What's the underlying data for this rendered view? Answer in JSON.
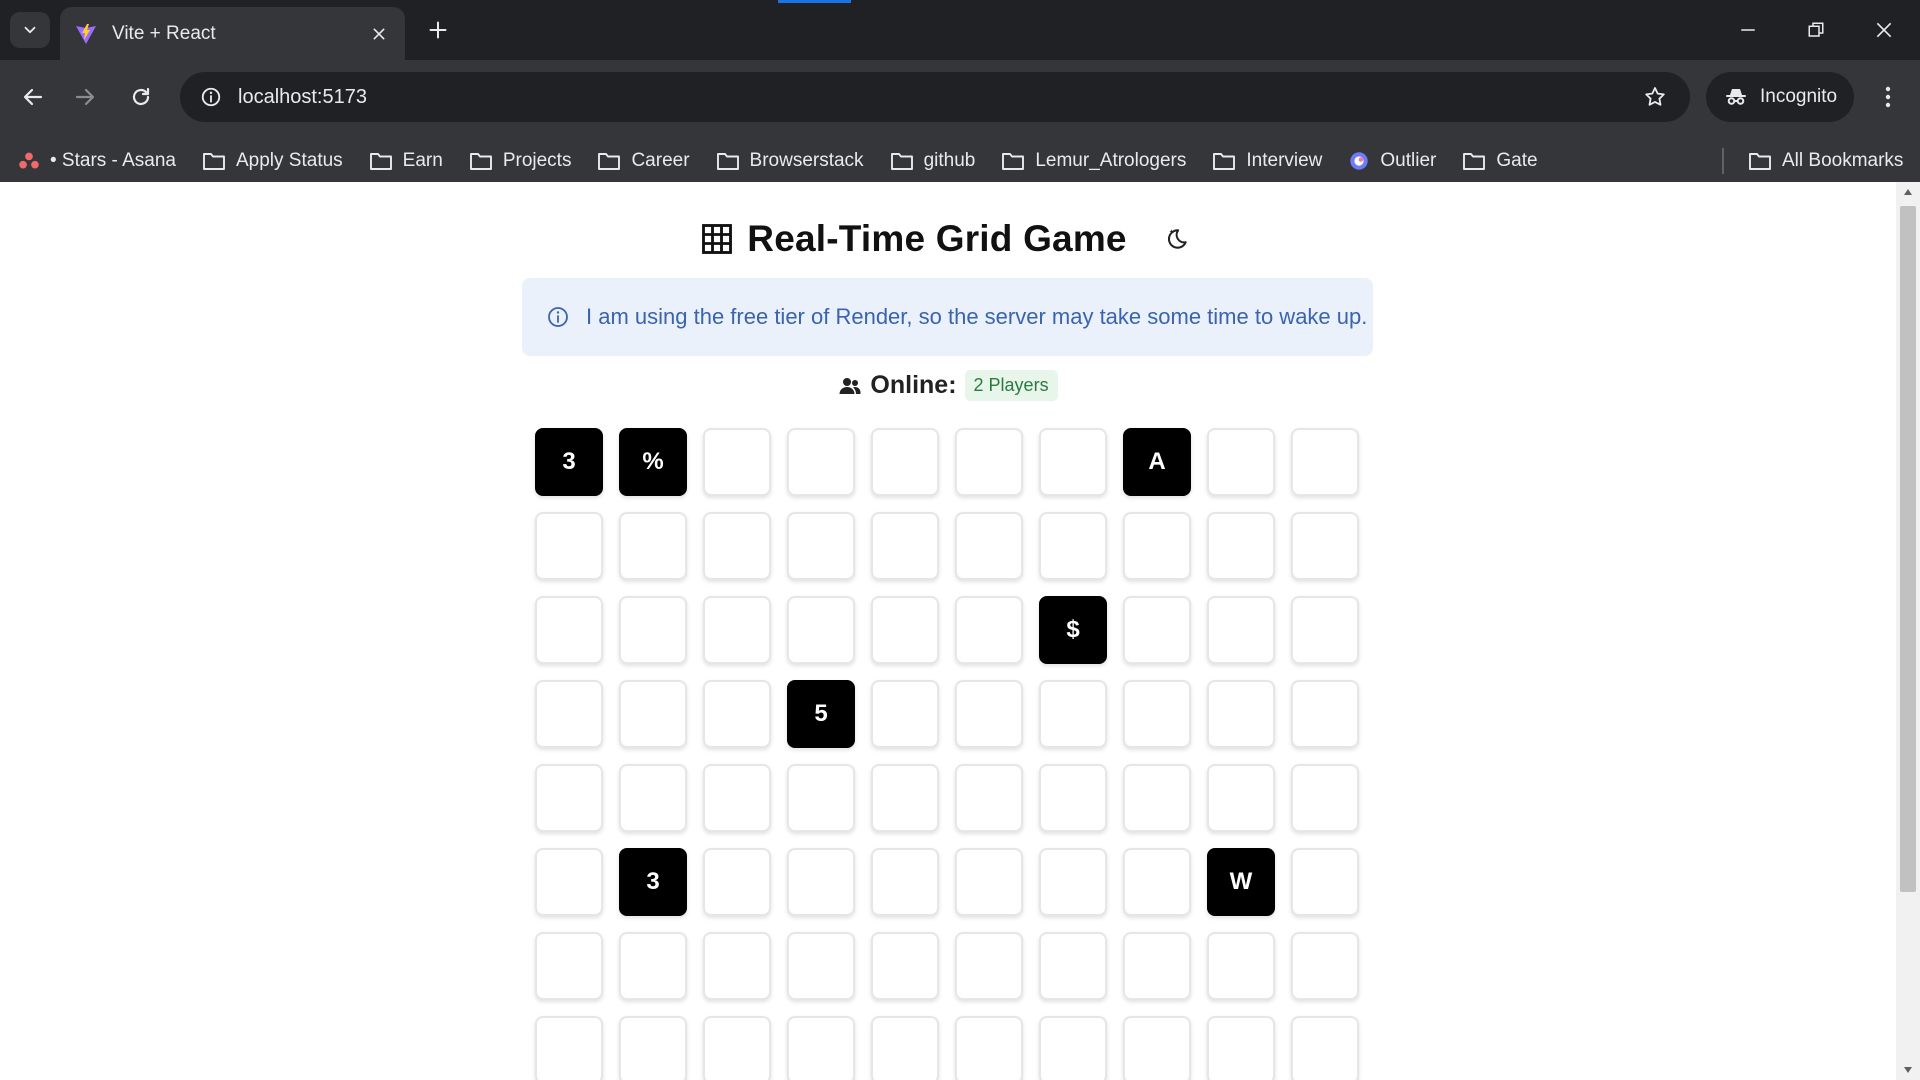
{
  "browser": {
    "tab_title": "Vite + React",
    "url": "localhost:5173",
    "profile_label": "Incognito",
    "bookmarks": [
      {
        "label": "• Stars - Asana",
        "icon": "asana-icon"
      },
      {
        "label": "Apply Status",
        "icon": "folder-icon"
      },
      {
        "label": "Earn",
        "icon": "folder-icon"
      },
      {
        "label": "Projects",
        "icon": "folder-icon"
      },
      {
        "label": "Career",
        "icon": "folder-icon"
      },
      {
        "label": "Browserstack",
        "icon": "folder-icon"
      },
      {
        "label": "github",
        "icon": "folder-icon"
      },
      {
        "label": "Lemur_Atrologers",
        "icon": "folder-icon"
      },
      {
        "label": "Interview",
        "icon": "folder-icon"
      },
      {
        "label": "Outlier",
        "icon": "outlier-icon"
      },
      {
        "label": "Gate",
        "icon": "folder-icon"
      }
    ],
    "all_bookmarks_label": "All Bookmarks"
  },
  "page": {
    "title": "Real-Time Grid Game",
    "notice": "I am using the free tier of Render, so the server may take some time to wake up.",
    "online_label": "Online:",
    "players_badge": "2 Players"
  },
  "grid": {
    "columns": 10,
    "rows": [
      [
        "3",
        "%",
        "",
        "",
        "",
        "",
        "",
        "A",
        "",
        ""
      ],
      [
        "",
        "",
        "",
        "",
        "",
        "",
        "",
        "",
        "",
        ""
      ],
      [
        "",
        "",
        "",
        "",
        "",
        "",
        "$",
        "",
        "",
        ""
      ],
      [
        "",
        "",
        "",
        "5",
        "",
        "",
        "",
        "",
        "",
        ""
      ],
      [
        "",
        "",
        "",
        "",
        "",
        "",
        "",
        "",
        "",
        ""
      ],
      [
        "",
        "3",
        "",
        "",
        "",
        "",
        "",
        "",
        "W",
        ""
      ],
      [
        "",
        "",
        "",
        "",
        "",
        "",
        "",
        "",
        "",
        ""
      ],
      [
        "",
        "",
        "",
        "",
        "",
        "",
        "",
        "",
        "",
        ""
      ]
    ]
  },
  "colors": {
    "filled_cell": "#000000",
    "notice_bg": "#eaf1fb",
    "notice_text": "#3a63b0",
    "badge_bg": "#e7f5eb",
    "badge_text": "#2d7a3e"
  }
}
